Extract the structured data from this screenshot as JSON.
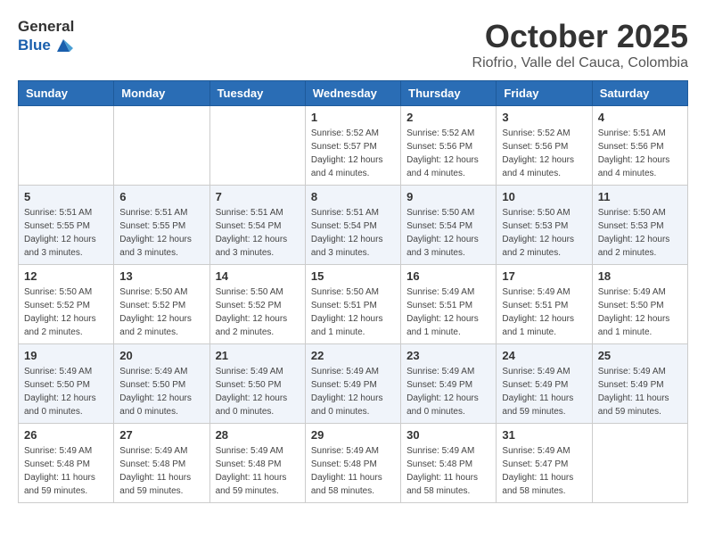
{
  "header": {
    "logo_general": "General",
    "logo_blue": "Blue",
    "month_title": "October 2025",
    "location": "Riofrio, Valle del Cauca, Colombia"
  },
  "days_of_week": [
    "Sunday",
    "Monday",
    "Tuesday",
    "Wednesday",
    "Thursday",
    "Friday",
    "Saturday"
  ],
  "weeks": [
    {
      "cells": [
        {
          "day": "",
          "info": ""
        },
        {
          "day": "",
          "info": ""
        },
        {
          "day": "",
          "info": ""
        },
        {
          "day": "1",
          "info": "Sunrise: 5:52 AM\nSunset: 5:57 PM\nDaylight: 12 hours\nand 4 minutes."
        },
        {
          "day": "2",
          "info": "Sunrise: 5:52 AM\nSunset: 5:56 PM\nDaylight: 12 hours\nand 4 minutes."
        },
        {
          "day": "3",
          "info": "Sunrise: 5:52 AM\nSunset: 5:56 PM\nDaylight: 12 hours\nand 4 minutes."
        },
        {
          "day": "4",
          "info": "Sunrise: 5:51 AM\nSunset: 5:56 PM\nDaylight: 12 hours\nand 4 minutes."
        }
      ]
    },
    {
      "cells": [
        {
          "day": "5",
          "info": "Sunrise: 5:51 AM\nSunset: 5:55 PM\nDaylight: 12 hours\nand 3 minutes."
        },
        {
          "day": "6",
          "info": "Sunrise: 5:51 AM\nSunset: 5:55 PM\nDaylight: 12 hours\nand 3 minutes."
        },
        {
          "day": "7",
          "info": "Sunrise: 5:51 AM\nSunset: 5:54 PM\nDaylight: 12 hours\nand 3 minutes."
        },
        {
          "day": "8",
          "info": "Sunrise: 5:51 AM\nSunset: 5:54 PM\nDaylight: 12 hours\nand 3 minutes."
        },
        {
          "day": "9",
          "info": "Sunrise: 5:50 AM\nSunset: 5:54 PM\nDaylight: 12 hours\nand 3 minutes."
        },
        {
          "day": "10",
          "info": "Sunrise: 5:50 AM\nSunset: 5:53 PM\nDaylight: 12 hours\nand 2 minutes."
        },
        {
          "day": "11",
          "info": "Sunrise: 5:50 AM\nSunset: 5:53 PM\nDaylight: 12 hours\nand 2 minutes."
        }
      ]
    },
    {
      "cells": [
        {
          "day": "12",
          "info": "Sunrise: 5:50 AM\nSunset: 5:52 PM\nDaylight: 12 hours\nand 2 minutes."
        },
        {
          "day": "13",
          "info": "Sunrise: 5:50 AM\nSunset: 5:52 PM\nDaylight: 12 hours\nand 2 minutes."
        },
        {
          "day": "14",
          "info": "Sunrise: 5:50 AM\nSunset: 5:52 PM\nDaylight: 12 hours\nand 2 minutes."
        },
        {
          "day": "15",
          "info": "Sunrise: 5:50 AM\nSunset: 5:51 PM\nDaylight: 12 hours\nand 1 minute."
        },
        {
          "day": "16",
          "info": "Sunrise: 5:49 AM\nSunset: 5:51 PM\nDaylight: 12 hours\nand 1 minute."
        },
        {
          "day": "17",
          "info": "Sunrise: 5:49 AM\nSunset: 5:51 PM\nDaylight: 12 hours\nand 1 minute."
        },
        {
          "day": "18",
          "info": "Sunrise: 5:49 AM\nSunset: 5:50 PM\nDaylight: 12 hours\nand 1 minute."
        }
      ]
    },
    {
      "cells": [
        {
          "day": "19",
          "info": "Sunrise: 5:49 AM\nSunset: 5:50 PM\nDaylight: 12 hours\nand 0 minutes."
        },
        {
          "day": "20",
          "info": "Sunrise: 5:49 AM\nSunset: 5:50 PM\nDaylight: 12 hours\nand 0 minutes."
        },
        {
          "day": "21",
          "info": "Sunrise: 5:49 AM\nSunset: 5:50 PM\nDaylight: 12 hours\nand 0 minutes."
        },
        {
          "day": "22",
          "info": "Sunrise: 5:49 AM\nSunset: 5:49 PM\nDaylight: 12 hours\nand 0 minutes."
        },
        {
          "day": "23",
          "info": "Sunrise: 5:49 AM\nSunset: 5:49 PM\nDaylight: 12 hours\nand 0 minutes."
        },
        {
          "day": "24",
          "info": "Sunrise: 5:49 AM\nSunset: 5:49 PM\nDaylight: 11 hours\nand 59 minutes."
        },
        {
          "day": "25",
          "info": "Sunrise: 5:49 AM\nSunset: 5:49 PM\nDaylight: 11 hours\nand 59 minutes."
        }
      ]
    },
    {
      "cells": [
        {
          "day": "26",
          "info": "Sunrise: 5:49 AM\nSunset: 5:48 PM\nDaylight: 11 hours\nand 59 minutes."
        },
        {
          "day": "27",
          "info": "Sunrise: 5:49 AM\nSunset: 5:48 PM\nDaylight: 11 hours\nand 59 minutes."
        },
        {
          "day": "28",
          "info": "Sunrise: 5:49 AM\nSunset: 5:48 PM\nDaylight: 11 hours\nand 59 minutes."
        },
        {
          "day": "29",
          "info": "Sunrise: 5:49 AM\nSunset: 5:48 PM\nDaylight: 11 hours\nand 58 minutes."
        },
        {
          "day": "30",
          "info": "Sunrise: 5:49 AM\nSunset: 5:48 PM\nDaylight: 11 hours\nand 58 minutes."
        },
        {
          "day": "31",
          "info": "Sunrise: 5:49 AM\nSunset: 5:47 PM\nDaylight: 11 hours\nand 58 minutes."
        },
        {
          "day": "",
          "info": ""
        }
      ]
    }
  ]
}
